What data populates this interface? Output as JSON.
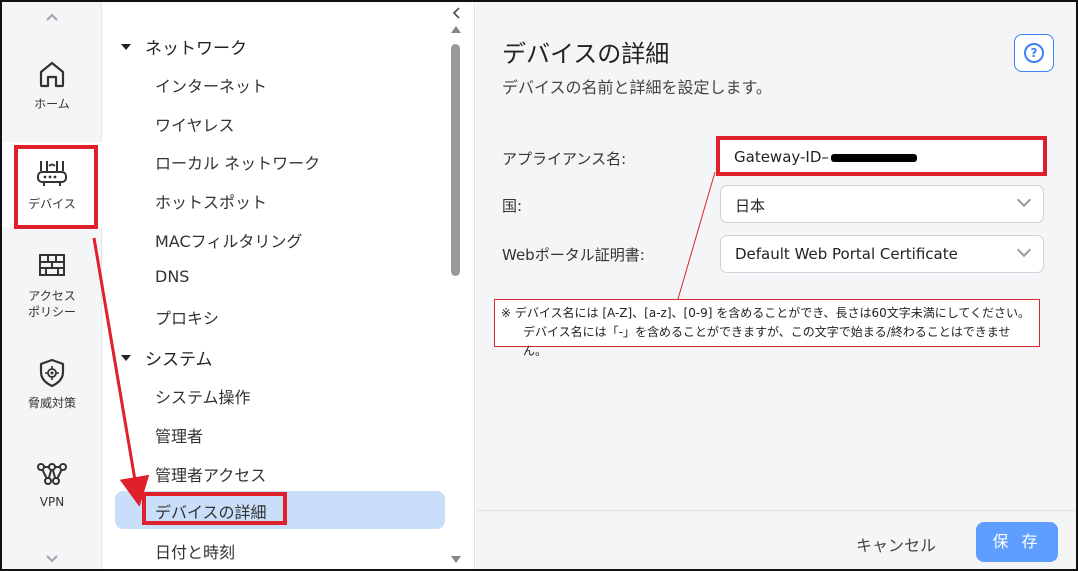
{
  "rail": {
    "items": [
      {
        "label": "ホーム",
        "icon": "home-icon"
      },
      {
        "label": "デバイス",
        "icon": "router-icon"
      },
      {
        "label": "アクセス\nポリシー",
        "icon": "firewall-icon"
      },
      {
        "label": "脅威対策",
        "icon": "shield-icon"
      },
      {
        "label": "VPN",
        "icon": "network-nodes-icon"
      }
    ]
  },
  "tree": {
    "groups": [
      {
        "label": "ネットワーク",
        "items": [
          "インターネット",
          "ワイヤレス",
          "ローカル ネットワーク",
          "ホットスポット",
          "MACフィルタリング",
          "DNS",
          "プロキシ"
        ]
      },
      {
        "label": "システム",
        "items": [
          "システム操作",
          "管理者",
          "管理者アクセス",
          "デバイスの詳細",
          "日付と時刻"
        ]
      }
    ],
    "selected": "デバイスの詳細"
  },
  "main": {
    "title": "デバイスの詳細",
    "subtitle": "デバイスの名前と詳細を設定します。",
    "fields": {
      "appliance_name_label": "アプライアンス名:",
      "appliance_name_value": "Gateway-ID–",
      "country_label": "国:",
      "country_value": "日本",
      "cert_label": "Webポータル証明書:",
      "cert_value": "Default Web Portal Certificate"
    },
    "note_line1": "※ デバイス名には [A-Z]、[a-z]、[0-9] を含めることができ、長さは60文字未満にしてください。",
    "note_line2": "デバイス名には「-」を含めることができますが、この文字で始まる/終わることはできません。",
    "cancel_label": "キャンセル",
    "save_label": "保 存"
  },
  "colors": {
    "accent": "#3b82f6",
    "save_button": "#5d9eff",
    "selected_bg": "#c9def8",
    "annotation_red": "#e0202a"
  }
}
